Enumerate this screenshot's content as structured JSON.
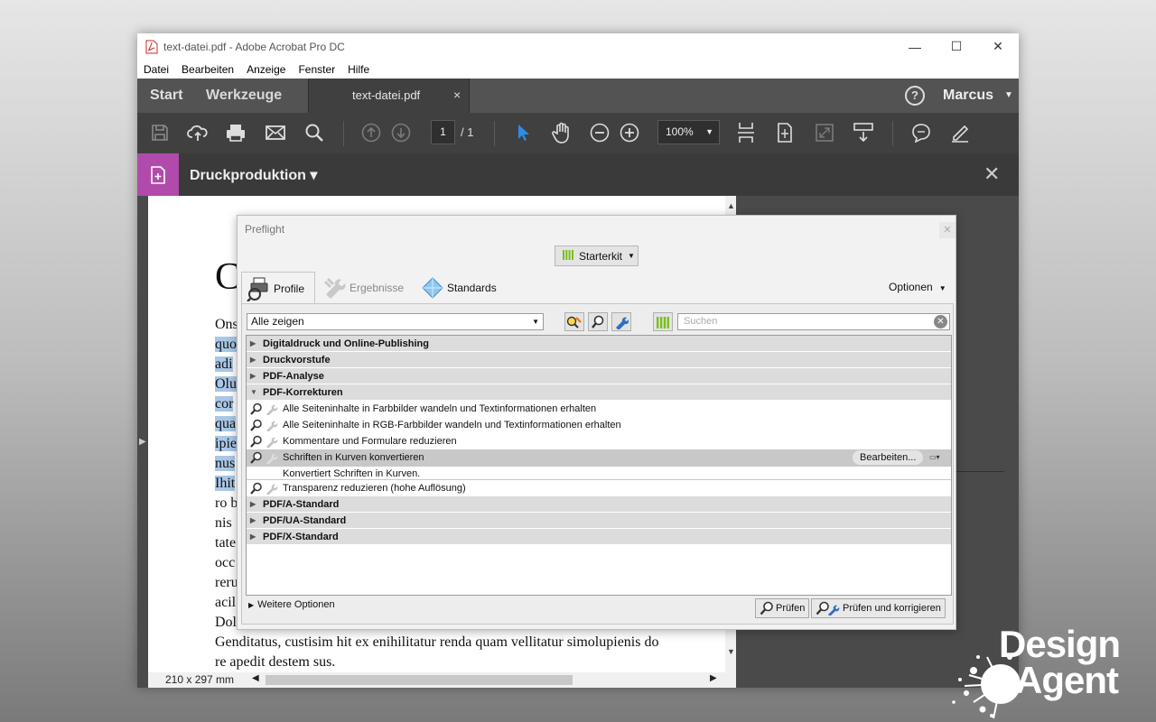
{
  "window": {
    "title": "text-datei.pdf - Adobe Acrobat Pro DC",
    "controls": {
      "minimize": "—",
      "maximize": "☐",
      "close": "✕"
    }
  },
  "menu": [
    "Datei",
    "Bearbeiten",
    "Anzeige",
    "Fenster",
    "Hilfe"
  ],
  "tabs": {
    "start": "Start",
    "tools": "Werkzeuge",
    "document": "text-datei.pdf",
    "document_close": "×",
    "help": "?",
    "user": "Marcus"
  },
  "toolbar": {
    "page_current": "1",
    "page_total": "/ 1",
    "zoom": "100%",
    "icons": [
      "save-icon",
      "upload-cloud-icon",
      "print-icon",
      "mail-icon",
      "search-icon",
      "page-up-icon",
      "page-down-icon",
      "select-cursor-icon",
      "hand-icon",
      "zoom-out-icon",
      "zoom-in-icon",
      "fit-page-icon",
      "scroll-icon",
      "fullscreen-icon",
      "read-mode-icon",
      "comment-icon",
      "pen-icon"
    ]
  },
  "tool_header": {
    "name": "Druckproduktion",
    "caret": "▾",
    "close": "✕"
  },
  "document": {
    "big_letter": "C",
    "lines": [
      {
        "text": "Ons",
        "hl": false
      },
      {
        "text": "quo",
        "hl": true
      },
      {
        "text": "adi",
        "hl": true
      },
      {
        "text": "Olu",
        "hl": true
      },
      {
        "text": "cor",
        "hl": true
      },
      {
        "text": "qua",
        "hl": true
      },
      {
        "text": "ipie",
        "hl": true
      },
      {
        "text": "nus",
        "hl": true
      },
      {
        "text": "Ihit",
        "hl": true
      },
      {
        "text": "ro b",
        "hl": false
      },
      {
        "text": "nis",
        "hl": false
      },
      {
        "text": "tate",
        "hl": false
      },
      {
        "text": "occ",
        "hl": false
      },
      {
        "text": "reru",
        "hl": false
      },
      {
        "text": "acil",
        "hl": false
      },
      {
        "text": "Dol",
        "hl": false
      },
      {
        "text": "Genditatus, custisim hit ex enihilitatur renda quam vellitatur simolupienis do",
        "hl": false
      },
      {
        "text": "re apedit destem sus.",
        "hl": false
      }
    ],
    "page_size": "210 x 297 mm"
  },
  "preflight": {
    "title": "Preflight",
    "close": "✕",
    "library": "Starterkit",
    "tabs": {
      "profiles": "Profile",
      "results": "Ergebnisse",
      "standards": "Standards"
    },
    "options": "Optionen",
    "filter": "Alle zeigen",
    "search_placeholder": "Suchen",
    "groups_before": [
      "Digitaldruck und Online-Publishing",
      "Druckvorstufe",
      "PDF-Analyse"
    ],
    "open_group": "PDF-Korrekturen",
    "items": [
      "Alle Seiteninhalte in Farbbilder wandeln und Textinformationen erhalten",
      "Alle Seiteninhalte in RGB-Farbbilder wandeln und Textinformationen erhalten",
      "Kommentare und Formulare reduzieren"
    ],
    "selected_item": "Schriften in Kurven konvertieren",
    "selected_desc": "Konvertiert Schriften in Kurven.",
    "edit_button": "Bearbeiten...",
    "item_after": "Transparenz reduzieren (hohe Auflösung)",
    "groups_after": [
      "PDF/A-Standard",
      "PDF/UA-Standard",
      "PDF/X-Standard"
    ],
    "more_options": "Weitere Optionen",
    "analyze": "Prüfen",
    "analyze_fix": "Prüfen und korrigieren"
  },
  "brand": {
    "line1": "Design",
    "line2": "Agent"
  },
  "colors": {
    "tool_accent": "#b14bab",
    "highlight": "#a9c7e6",
    "select_cursor": "#2d8ceb",
    "starter_green": "#7bbf1e"
  }
}
